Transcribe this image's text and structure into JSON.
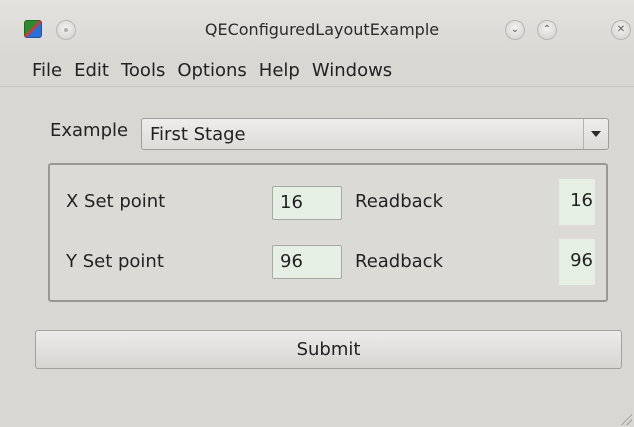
{
  "window": {
    "title": "QEConfiguredLayoutExample"
  },
  "titlebar_buttons": {
    "sticky_icon": "circle-dot-icon",
    "minimize_glyph": "⌄",
    "maximize_glyph": "⌃",
    "close_glyph": "✕"
  },
  "menu": {
    "items": [
      "File",
      "Edit",
      "Tools",
      "Options",
      "Help",
      "Windows"
    ]
  },
  "example": {
    "label": "Example",
    "selected": "First Stage"
  },
  "rows": [
    {
      "setpoint_label": "X Set point",
      "setpoint_value": "16",
      "readback_label": "Readback",
      "readback_value": "16"
    },
    {
      "setpoint_label": "Y Set point",
      "setpoint_value": "96",
      "readback_label": "Readback",
      "readback_value": "96"
    }
  ],
  "submit": {
    "label": "Submit"
  },
  "colors": {
    "window_bg": "#d9d7d4",
    "field_bg": "#e6efe4",
    "border": "#9a9895"
  }
}
